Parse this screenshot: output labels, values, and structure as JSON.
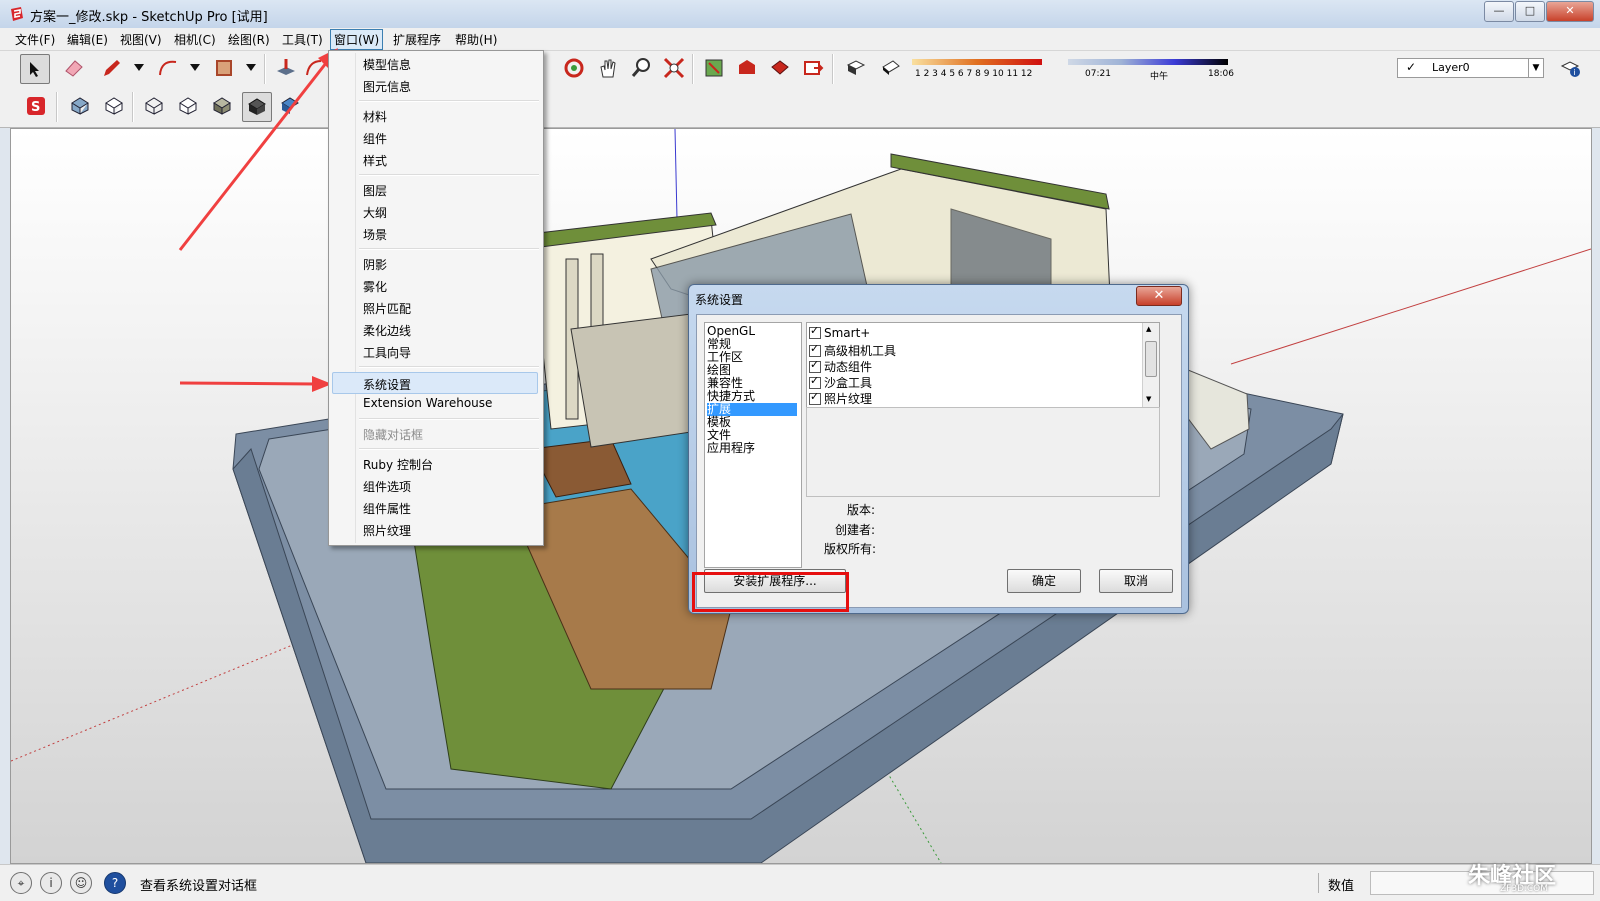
{
  "window": {
    "title": "方案一_修改.skp - SketchUp Pro [试用]",
    "controls": {
      "minimize": "—",
      "maximize": "□",
      "close": "✕"
    }
  },
  "menubar": {
    "items": [
      "文件(F)",
      "编辑(E)",
      "视图(V)",
      "相机(C)",
      "绘图(R)",
      "工具(T)",
      "窗口(W)",
      "扩展程序",
      "帮助(H)"
    ],
    "active": "窗口(W)"
  },
  "toolbar": {
    "shadow_months": "1 2 3 4 5 6 7 8 9 10 11 12",
    "time_start": "07:21",
    "time_mid": "中午",
    "time_end": "18:06",
    "layer": "Layer0"
  },
  "window_menu": {
    "items": [
      {
        "label": "模型信息"
      },
      {
        "label": "图元信息"
      },
      {
        "label": "材料"
      },
      {
        "label": "组件"
      },
      {
        "label": "样式"
      },
      {
        "label": "图层"
      },
      {
        "label": "大纲"
      },
      {
        "label": "场景"
      },
      {
        "label": "阴影"
      },
      {
        "label": "雾化"
      },
      {
        "label": "照片匹配"
      },
      {
        "label": "柔化边线"
      },
      {
        "label": "工具向导"
      },
      {
        "label": "系统设置"
      },
      {
        "label": "Extension Warehouse"
      },
      {
        "label": "隐藏对话框"
      },
      {
        "label": "Ruby 控制台"
      },
      {
        "label": "组件选项"
      },
      {
        "label": "组件属性"
      },
      {
        "label": "照片纹理"
      }
    ],
    "highlighted": "系统设置",
    "disabled": "隐藏对话框"
  },
  "preferences_dialog": {
    "title": "系统设置",
    "categories": [
      "OpenGL",
      "常规",
      "工作区",
      "绘图",
      "兼容性",
      "快捷方式",
      "扩展",
      "模板",
      "文件",
      "应用程序"
    ],
    "selected_category": "扩展",
    "extensions": [
      {
        "name": "Smart+",
        "checked": true
      },
      {
        "name": "高级相机工具",
        "checked": true
      },
      {
        "name": "动态组件",
        "checked": true
      },
      {
        "name": "沙盒工具",
        "checked": true
      },
      {
        "name": "照片纹理",
        "checked": true
      }
    ],
    "version_label": "版本:",
    "creator_label": "创建者:",
    "copyright_label": "版权所有:",
    "install_button": "安装扩展程序...",
    "ok_button": "确定",
    "cancel_button": "取消"
  },
  "statusbar": {
    "message": "查看系统设置对话框",
    "measurements_label": "数值",
    "measurements_value": ""
  },
  "watermark": {
    "text": "朱峰社区",
    "sub": "ZF3D.COM"
  },
  "colors": {
    "highlight_red": "#e60f0f",
    "selection_blue": "#3399ff",
    "menu_hover": "#dbe9f9"
  }
}
